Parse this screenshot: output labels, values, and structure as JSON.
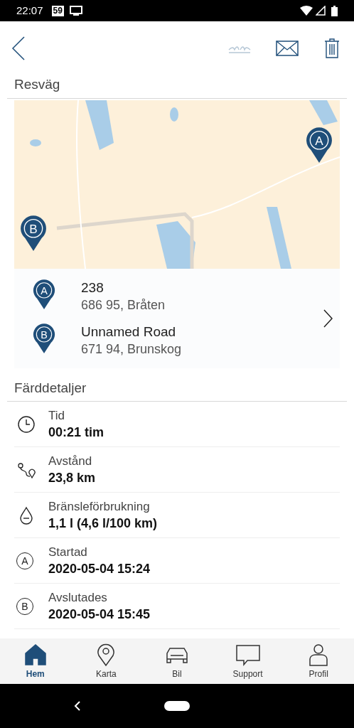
{
  "status_bar": {
    "time": "22:07",
    "badge": "59"
  },
  "section_route": {
    "title": "Resväg"
  },
  "map": {
    "markers": [
      {
        "label": "A"
      },
      {
        "label": "B"
      }
    ]
  },
  "addresses": [
    {
      "pin": "A",
      "street": "238",
      "place": "686 95, Bråten"
    },
    {
      "pin": "B",
      "street": "Unnamed Road",
      "place": "671 94, Brunskog"
    }
  ],
  "section_details": {
    "title": "Färddetaljer"
  },
  "details": [
    {
      "kind": "clock",
      "label": "Tid",
      "value": "00:21 tim"
    },
    {
      "kind": "route",
      "label": "Avstånd",
      "value": "23,8 km"
    },
    {
      "kind": "drop",
      "label": "Bränsleförbrukning",
      "value": "1,1 l (4,6 l/100 km)"
    },
    {
      "kind": "letter",
      "letter": "A",
      "label": "Startad",
      "value": "2020-05-04 15:24"
    },
    {
      "kind": "letter",
      "letter": "B",
      "label": "Avslutades",
      "value": "2020-05-04 15:45"
    }
  ],
  "nav": [
    {
      "kind": "home",
      "label": "Hem",
      "selected": true
    },
    {
      "kind": "pin",
      "label": "Karta",
      "selected": false
    },
    {
      "kind": "car",
      "label": "Bil",
      "selected": false
    },
    {
      "kind": "chat",
      "label": "Support",
      "selected": false
    },
    {
      "kind": "person",
      "label": "Profil",
      "selected": false
    }
  ]
}
